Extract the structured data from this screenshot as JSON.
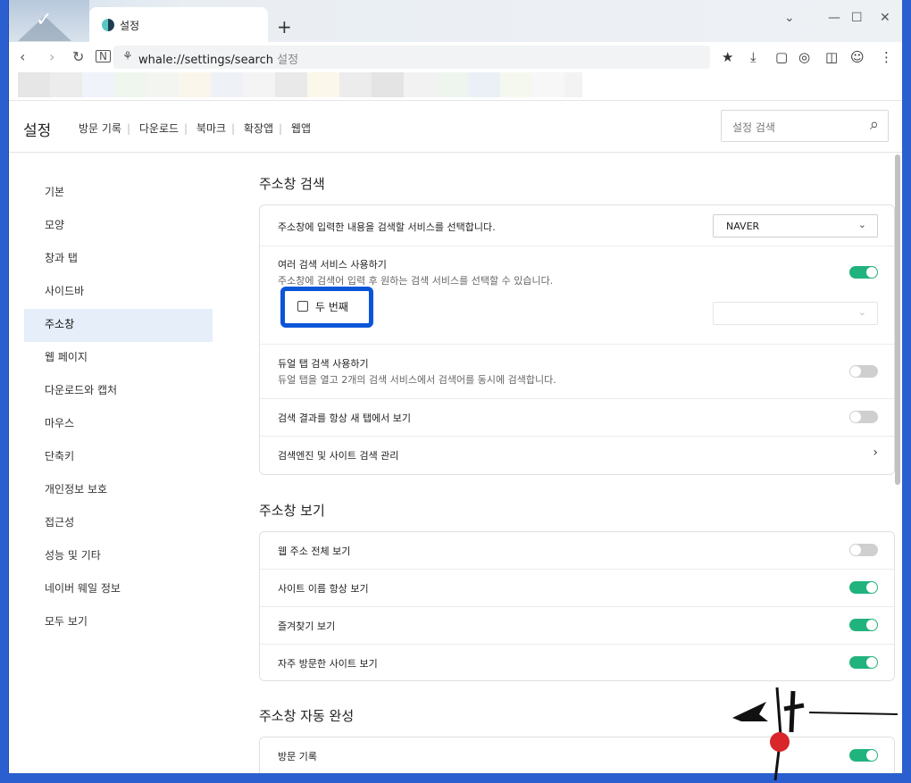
{
  "browser": {
    "tab_title": "설정",
    "new_tab": "+",
    "window_controls": [
      "⌄",
      "—",
      "☐",
      "✕"
    ],
    "url": "whale://settings/search",
    "url_tail": "설정"
  },
  "header": {
    "brand": "설정",
    "links": [
      "방문 기록",
      "다운로드",
      "북마크",
      "확장앱",
      "웹앱"
    ],
    "search_placeholder": "설정 검색"
  },
  "sidebar": {
    "items": [
      {
        "label": "기본"
      },
      {
        "label": "모양"
      },
      {
        "label": "창과 탭"
      },
      {
        "label": "사이드바"
      },
      {
        "label": "주소창",
        "active": true
      },
      {
        "label": "웹 페이지"
      },
      {
        "label": "다운로드와 캡처"
      },
      {
        "label": "마우스"
      },
      {
        "label": "단축키"
      },
      {
        "label": "개인정보 보호"
      },
      {
        "label": "접근성"
      },
      {
        "label": "성능 및 기타"
      },
      {
        "label": "네이버 웨일 정보"
      },
      {
        "label": "모두 보기"
      }
    ]
  },
  "sections": {
    "search": {
      "title": "주소창 검색",
      "engine_label": "주소창에 입력한 내용을 검색할 서비스를 선택합니다.",
      "engine_value": "NAVER",
      "multi_label": "여러 검색 서비스 사용하기",
      "multi_sub": "주소창에 검색어 입력 후 원하는 검색 서비스를 선택할 수 있습니다.",
      "multi_on": true,
      "second_label": "두 번째",
      "dual_label": "듀얼 탭 검색 사용하기",
      "dual_sub": "듀얼 탭을 열고 2개의 검색 서비스에서 검색어를 동시에 검색합니다.",
      "dual_on": false,
      "newtab_label": "검색 결과를 항상 새 탭에서 보기",
      "newtab_on": false,
      "manage_label": "검색엔진 및 사이트 검색 관리"
    },
    "view": {
      "title": "주소창 보기",
      "rows": [
        {
          "label": "웹 주소 전체 보기",
          "on": false
        },
        {
          "label": "사이트 이름 항상 보기",
          "on": true
        },
        {
          "label": "즐겨찾기 보기",
          "on": true
        },
        {
          "label": "자주 방문한 사이트 보기",
          "on": true
        }
      ]
    },
    "autocomplete": {
      "title": "주소창 자동 완성",
      "rows": [
        {
          "label": "방문 기록",
          "on": true
        }
      ]
    }
  },
  "colors": {
    "toggle_on": "#21b37d",
    "toggle_off": "#cfcfcf",
    "highlight": "#0a55d8",
    "active_sidebar": "#e5eef9",
    "frame": "#2b5fd0"
  }
}
